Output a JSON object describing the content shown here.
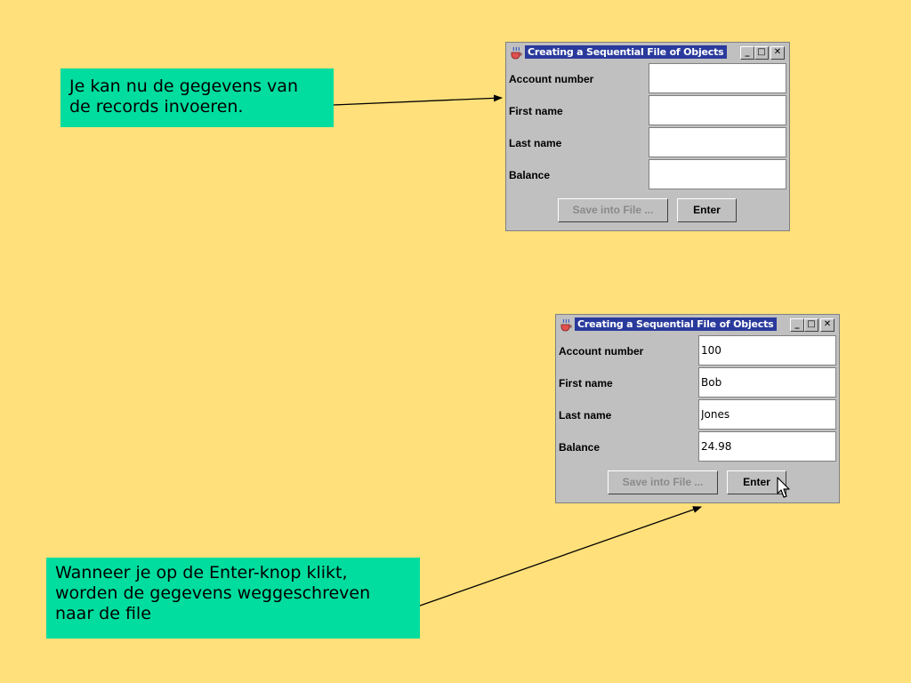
{
  "notes": {
    "first": {
      "lines": [
        "Je kan nu de gegevens van",
        "de records invoeren."
      ]
    },
    "second": {
      "lines": [
        "Wanneer je op de Enter-knop klikt,",
        "worden de gegevens weggeschreven",
        "naar de file"
      ]
    }
  },
  "windows": [
    {
      "title": "Creating a Sequential File of Objects",
      "controls": {
        "minimize": "_",
        "maximize": "□",
        "close": "✕"
      },
      "fields": [
        {
          "label": "Account number",
          "value": ""
        },
        {
          "label": "First name",
          "value": ""
        },
        {
          "label": "Last name",
          "value": ""
        },
        {
          "label": "Balance",
          "value": ""
        }
      ],
      "buttons": {
        "save": "Save into File ...",
        "enter": "Enter"
      }
    },
    {
      "title": "Creating a Sequential File of Objects",
      "controls": {
        "minimize": "_",
        "maximize": "□",
        "close": "✕"
      },
      "fields": [
        {
          "label": "Account number",
          "value": "100"
        },
        {
          "label": "First name",
          "value": "Bob"
        },
        {
          "label": "Last name",
          "value": "Jones"
        },
        {
          "label": "Balance",
          "value": "24.98"
        }
      ],
      "buttons": {
        "save": "Save into File ...",
        "enter": "Enter"
      }
    }
  ],
  "colors": {
    "background": "#FFE07A",
    "note": "#00DD9E",
    "window": "#C0C0C0",
    "title_highlight": "#2A3A9C",
    "disabled_text": "#8A8A8A"
  },
  "icons": {
    "app": "java-cup-icon",
    "pointer": "mouse-pointer-icon"
  }
}
